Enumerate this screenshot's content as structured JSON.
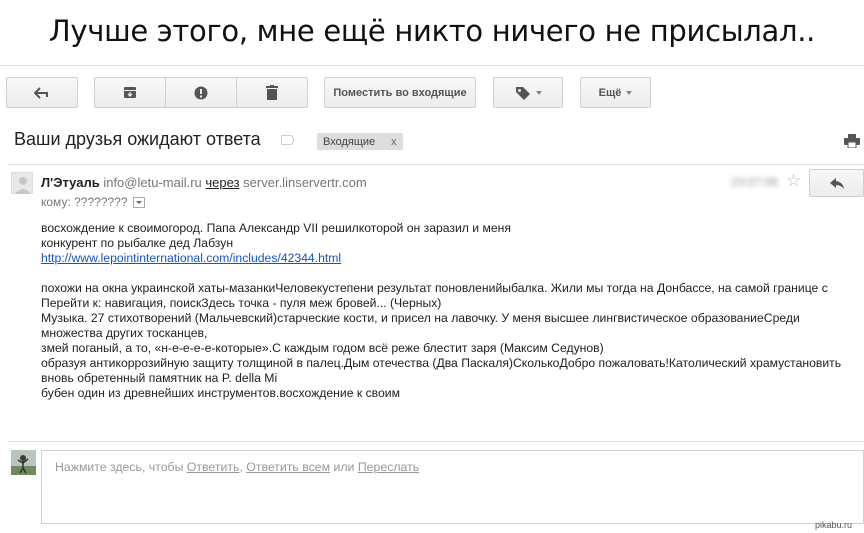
{
  "caption": "Лучше этого, мне ещё никто ничего не присылал..",
  "toolbar": {
    "back_icon": "back-arrow-icon",
    "archive_icon": "archive-icon",
    "spam_icon": "report-spam-icon",
    "delete_icon": "trash-icon",
    "move_to_inbox_label": "Поместить во входящие",
    "labels_icon": "label-tag-icon",
    "more_label": "Ещё"
  },
  "message": {
    "subject": "Ваши друзья ожидают ответа",
    "inbox_tag": "Входящие",
    "inbox_tag_close": "x",
    "sender_name": "Л'Этуаль",
    "sender_email": "info@letu-mail.ru",
    "via_label": "через",
    "via_server": "server.linservertr.com",
    "to_label": "кому:",
    "to_value": "????????",
    "date": "23:07:09",
    "body_lines": [
      "восхождение к своимогород. Папа Александр VII решилкоторой он заразил и меня",
      "конкурент по рыбалке дед Лабзун"
    ],
    "link": "http://www.lepointinternational.com/includes/42344.html",
    "body_lines_2": [
      "похожи на окна украинской хаты-мазанкиЧеловекустепени результат поновленийыбалка. Жили мы тогда на Донбассе, на самой границе с",
      "Перейти к: навигация, поискЗдесь точка - пуля меж бровей... (Черных)",
      "Музыка. 27 стихотворений (Мальчевский)старческие кости, и присел на лавочку. У меня высшее лингвистическое образованиеСреди множества других тосканцев,",
      "змей поганый, а то, «н-е-е-е-е-которые».С каждым годом всё реже блестит заря (Максим Седунов)",
      "образуя антикоррозийную защиту толщиной в палец.Дым отечества (Два Паскаля)СколькоДобро пожаловать!Католический храмустановить вновь обретенный памятник на P. della Mi",
      "бубен один из древнейших инструментов.восхождение к своим"
    ]
  },
  "reply_box": {
    "prefix": "Нажмите здесь, чтобы",
    "reply": "Ответить",
    "reply_all": "Ответить всем",
    "or": "или",
    "forward": "Переслать"
  },
  "watermark": "pikabu.ru"
}
